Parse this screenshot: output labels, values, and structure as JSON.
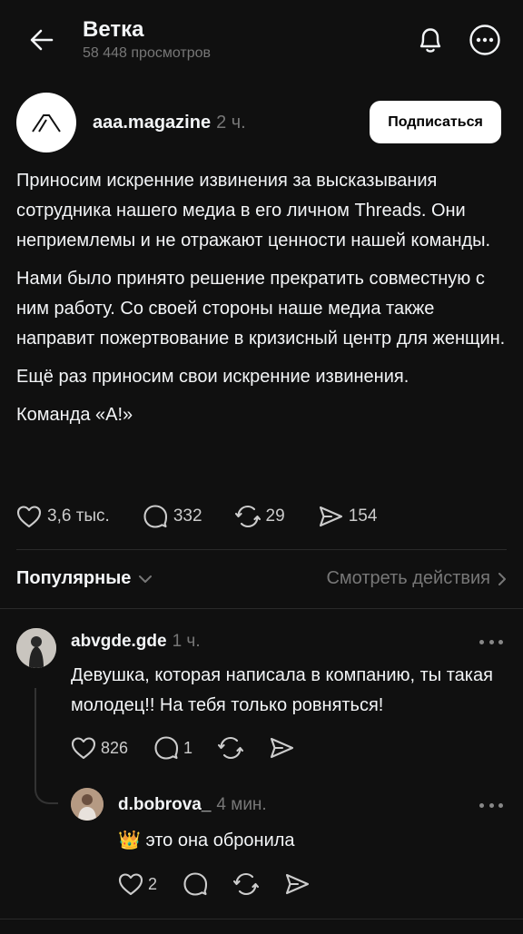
{
  "header": {
    "title": "Ветка",
    "views": "58 448 просмотров"
  },
  "post": {
    "author": "aaa.magazine",
    "time": "2 ч.",
    "follow_label": "Подписаться",
    "paragraphs": [
      "Приносим искренние извинения за высказывания сотрудника нашего медиа в его личном Threads. Они неприемлемы и не отражают ценности нашей команды.",
      "Нами было принято решение прекратить совместную с ним работу. Со своей стороны наше медиа также направит пожертвование в кризисный центр для женщин.",
      "Ещё раз приносим свои искренние извинения.",
      "Команда «А!»"
    ],
    "likes": "3,6 тыс.",
    "replies": "332",
    "reposts": "29",
    "shares": "154"
  },
  "sort": {
    "label": "Популярные",
    "activity_label": "Смотреть действия"
  },
  "comments": [
    {
      "author": "abvgde.gde",
      "time": "1 ч.",
      "text": "Девушка, которая написала в компанию, ты такая молодец!! На тебя только ровняться!",
      "likes": "826",
      "replies": "1"
    },
    {
      "author": "d.bobrova_",
      "time": "4 мин.",
      "emoji": "👑",
      "text": "это она обронила",
      "likes": "2"
    }
  ],
  "colors": {
    "background": "#101010",
    "text": "#f3f5f7",
    "muted": "#777777",
    "follow_button_bg": "#ffffff"
  }
}
